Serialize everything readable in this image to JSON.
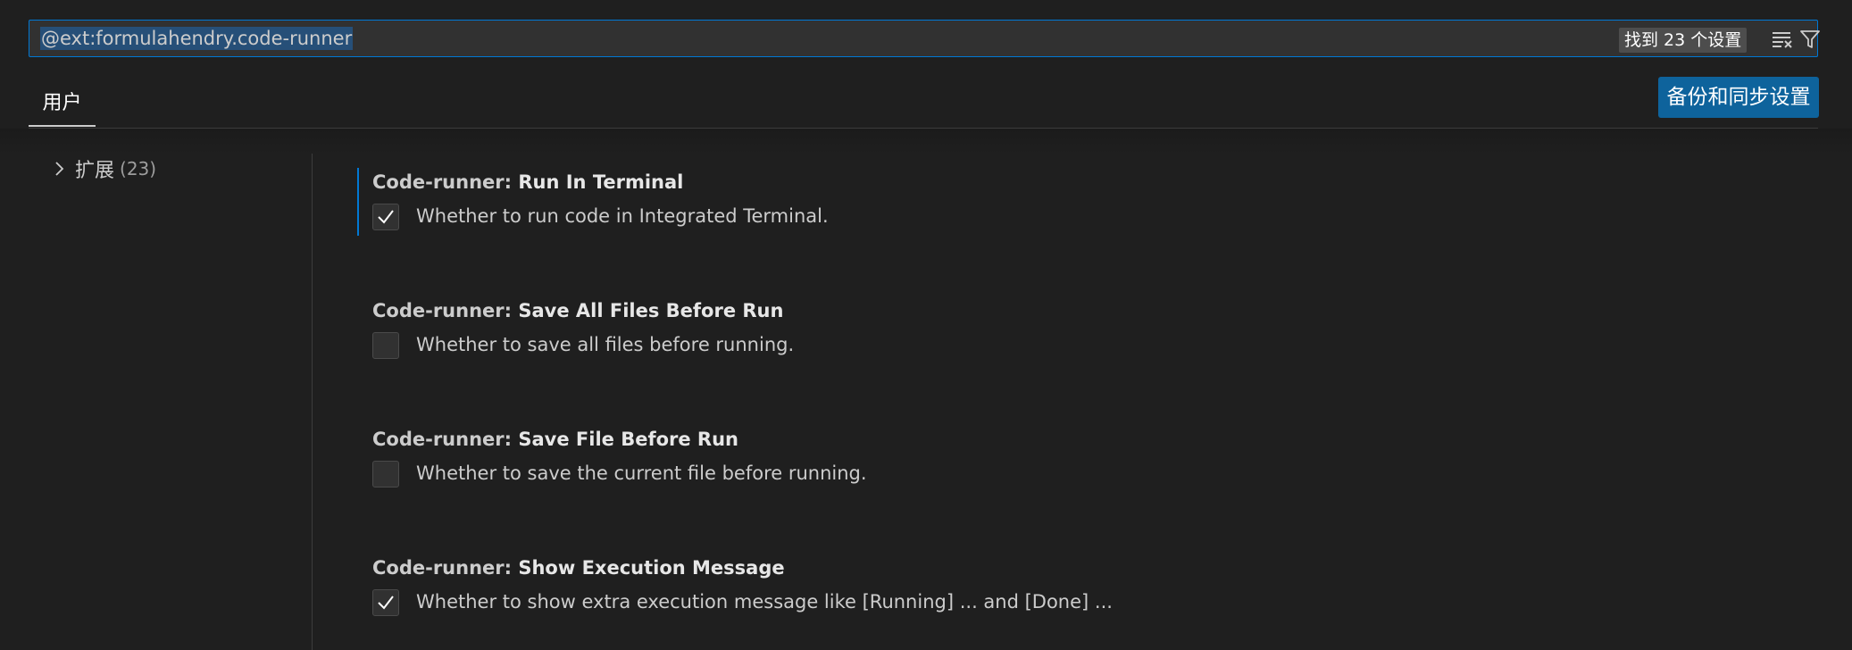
{
  "search": {
    "query": "@ext:formulahendry.code-runner",
    "result_count": "找到 23 个设置",
    "clear_icon": "clear-filter-icon",
    "filter_icon": "filter-icon"
  },
  "tabs": {
    "user": "用户"
  },
  "sync_button": "备份和同步设置",
  "toc": {
    "label": "扩展",
    "count": "(23)"
  },
  "settings": [
    {
      "category": "Code-runner: ",
      "label": "Run In Terminal",
      "description": "Whether to run code in Integrated Terminal.",
      "checked": true
    },
    {
      "category": "Code-runner: ",
      "label": "Save All Files Before Run",
      "description": "Whether to save all files before running.",
      "checked": false
    },
    {
      "category": "Code-runner: ",
      "label": "Save File Before Run",
      "description": "Whether to save the current file before running.",
      "checked": false
    },
    {
      "category": "Code-runner: ",
      "label": "Show Execution Message",
      "description": "Whether to show extra execution message like [Running] ... and [Done] ...",
      "checked": true
    }
  ],
  "colors": {
    "accent": "#0078d4",
    "button": "#0e639c",
    "selection": "#264f78",
    "background": "#1f1f1f"
  }
}
